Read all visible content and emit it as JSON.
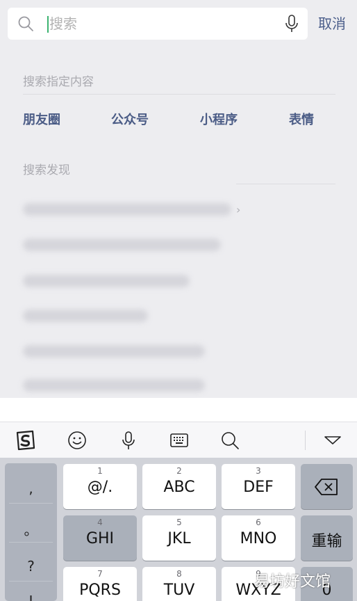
{
  "search": {
    "placeholder": "搜索",
    "cancel_label": "取消"
  },
  "specified": {
    "title": "搜索指定内容",
    "categories": [
      "朋友圈",
      "公众号",
      "小程序",
      "表情"
    ]
  },
  "discover": {
    "title": "搜索发现"
  },
  "keyboard": {
    "punctuation": [
      ",",
      "。",
      "?",
      "!"
    ],
    "rows": [
      [
        {
          "num": "1",
          "letters": "@/."
        },
        {
          "num": "2",
          "letters": "ABC"
        },
        {
          "num": "3",
          "letters": "DEF"
        }
      ],
      [
        {
          "num": "4",
          "letters": "GHI"
        },
        {
          "num": "5",
          "letters": "JKL"
        },
        {
          "num": "6",
          "letters": "MNO"
        }
      ],
      [
        {
          "num": "7",
          "letters": "PQRS"
        },
        {
          "num": "8",
          "letters": "TUV"
        },
        {
          "num": "9",
          "letters": "WXYZ"
        }
      ]
    ],
    "reenter_label": "重输",
    "zero_label": "0"
  },
  "watermark": "易坊好文馆",
  "colors": {
    "accent": "#4b5c86",
    "cursor": "#3cb371"
  }
}
